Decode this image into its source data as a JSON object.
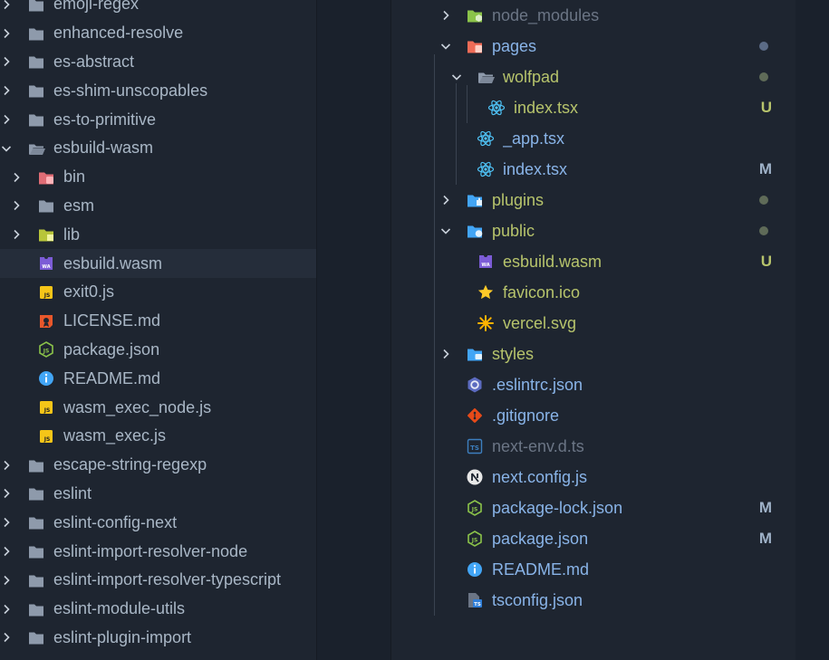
{
  "colors": {
    "folder": "#8e9aab",
    "text_default": "#a9b7c6",
    "text_untracked": "#b7c46c",
    "text_modified": "#89b4e8",
    "text_ignored": "#6b7585",
    "badge_U": "#b7c46c",
    "badge_M": "#9fb2c8",
    "dot_blue": "#5b6b86",
    "dot_green": "#5f6b58"
  },
  "left_tree": {
    "items": [
      {
        "name": "emoji-regex",
        "icon": "folder-icon",
        "expanded": false,
        "indent": 0
      },
      {
        "name": "enhanced-resolve",
        "icon": "folder-icon",
        "expanded": false,
        "indent": 0
      },
      {
        "name": "es-abstract",
        "icon": "folder-icon",
        "expanded": false,
        "indent": 0
      },
      {
        "name": "es-shim-unscopables",
        "icon": "folder-icon",
        "expanded": false,
        "indent": 0
      },
      {
        "name": "es-to-primitive",
        "icon": "folder-icon",
        "expanded": false,
        "indent": 0
      },
      {
        "name": "esbuild-wasm",
        "icon": "folder-open-icon",
        "expanded": true,
        "indent": 0
      },
      {
        "name": "bin",
        "icon": "folder-bin-icon",
        "expanded": false,
        "indent": 1
      },
      {
        "name": "esm",
        "icon": "folder-icon",
        "expanded": false,
        "indent": 1
      },
      {
        "name": "lib",
        "icon": "folder-lib-icon",
        "expanded": false,
        "indent": 1
      },
      {
        "name": "esbuild.wasm",
        "icon": "wasm-file-icon",
        "indent": 1,
        "selected": true
      },
      {
        "name": "exit0.js",
        "icon": "js-file-icon",
        "indent": 1
      },
      {
        "name": "LICENSE.md",
        "icon": "license-file-icon",
        "indent": 1
      },
      {
        "name": "package.json",
        "icon": "nodejs-file-icon",
        "indent": 1
      },
      {
        "name": "README.md",
        "icon": "info-file-icon",
        "indent": 1
      },
      {
        "name": "wasm_exec_node.js",
        "icon": "js-file-icon",
        "indent": 1
      },
      {
        "name": "wasm_exec.js",
        "icon": "js-file-icon",
        "indent": 1
      },
      {
        "name": "escape-string-regexp",
        "icon": "folder-icon",
        "expanded": false,
        "indent": 0
      },
      {
        "name": "eslint",
        "icon": "folder-icon",
        "expanded": false,
        "indent": 0
      },
      {
        "name": "eslint-config-next",
        "icon": "folder-icon",
        "expanded": false,
        "indent": 0
      },
      {
        "name": "eslint-import-resolver-node",
        "icon": "folder-icon",
        "expanded": false,
        "indent": 0
      },
      {
        "name": "eslint-import-resolver-typescript",
        "icon": "folder-icon",
        "expanded": false,
        "indent": 0
      },
      {
        "name": "eslint-module-utils",
        "icon": "folder-icon",
        "expanded": false,
        "indent": 0
      },
      {
        "name": "eslint-plugin-import",
        "icon": "folder-icon",
        "expanded": false,
        "indent": 0
      }
    ]
  },
  "right_tree": {
    "items": [
      {
        "name": "node_modules",
        "icon": "folder-node-icon",
        "expanded": false,
        "indent": 0,
        "status": "ignored"
      },
      {
        "name": "pages",
        "icon": "folder-pages-icon",
        "expanded": true,
        "indent": 0,
        "status": "modified",
        "dot": "blue"
      },
      {
        "name": "wolfpad",
        "icon": "folder-open-icon",
        "expanded": true,
        "indent": 1,
        "status": "untracked",
        "dot": "green"
      },
      {
        "name": "index.tsx",
        "icon": "react-icon",
        "indent": 2,
        "status": "untracked",
        "badge": "U"
      },
      {
        "name": "_app.tsx",
        "icon": "react-icon",
        "indent": 1,
        "status": "modified"
      },
      {
        "name": "index.tsx",
        "icon": "react-icon",
        "indent": 1,
        "status": "modified",
        "badge": "M"
      },
      {
        "name": "plugins",
        "icon": "folder-plugins-icon",
        "expanded": false,
        "indent": 0,
        "status": "untracked",
        "dot": "green"
      },
      {
        "name": "public",
        "icon": "folder-public-icon",
        "expanded": true,
        "indent": 0,
        "status": "untracked",
        "dot": "green"
      },
      {
        "name": "esbuild.wasm",
        "icon": "wasm-file-icon",
        "indent": 1,
        "status": "untracked",
        "badge": "U"
      },
      {
        "name": "favicon.ico",
        "icon": "star-icon",
        "indent": 1,
        "status": "untracked"
      },
      {
        "name": "vercel.svg",
        "icon": "svg-file-icon",
        "indent": 1,
        "status": "untracked"
      },
      {
        "name": "styles",
        "icon": "folder-styles-icon",
        "expanded": false,
        "indent": 0,
        "status": "untracked"
      },
      {
        "name": ".eslintrc.json",
        "icon": "eslint-icon",
        "indent": 0,
        "status": "modified"
      },
      {
        "name": ".gitignore",
        "icon": "git-icon",
        "indent": 0,
        "status": "modified"
      },
      {
        "name": "next-env.d.ts",
        "icon": "ts-file-icon",
        "indent": 0,
        "status": "ignored"
      },
      {
        "name": "next.config.js",
        "icon": "nextjs-icon",
        "indent": 0,
        "status": "modified"
      },
      {
        "name": "package-lock.json",
        "icon": "nodejs-file-icon",
        "indent": 0,
        "status": "modified",
        "badge": "M"
      },
      {
        "name": "package.json",
        "icon": "nodejs-file-icon",
        "indent": 0,
        "status": "modified",
        "badge": "M"
      },
      {
        "name": "README.md",
        "icon": "info-file-icon",
        "indent": 0,
        "status": "modified"
      },
      {
        "name": "tsconfig.json",
        "icon": "tsconfig-icon",
        "indent": 0,
        "status": "modified"
      }
    ]
  }
}
